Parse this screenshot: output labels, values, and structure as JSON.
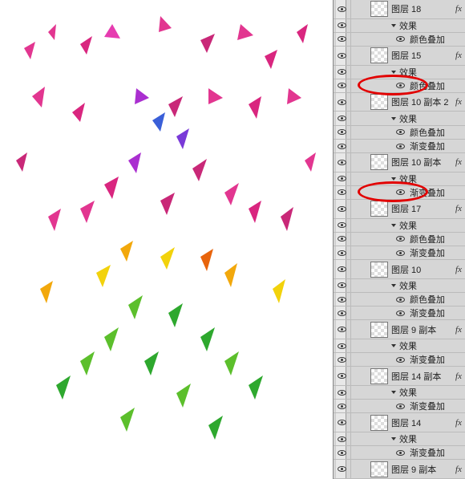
{
  "layers": [
    {
      "kind": "layer",
      "indent": 20,
      "name": "图层 18",
      "fx": "fx"
    },
    {
      "kind": "effects",
      "indent": 44,
      "name": "效果"
    },
    {
      "kind": "effect",
      "indent": 56,
      "name": "颜色叠加"
    },
    {
      "kind": "layer",
      "indent": 20,
      "name": "图层 15",
      "fx": "fx"
    },
    {
      "kind": "effects",
      "indent": 44,
      "name": "效果"
    },
    {
      "kind": "effect",
      "indent": 56,
      "name": "颜色叠加",
      "circled": true
    },
    {
      "kind": "layer",
      "indent": 20,
      "name": "图层 10 副本 2",
      "fx": "fx"
    },
    {
      "kind": "effects",
      "indent": 44,
      "name": "效果"
    },
    {
      "kind": "effect",
      "indent": 56,
      "name": "颜色叠加"
    },
    {
      "kind": "effect",
      "indent": 56,
      "name": "渐变叠加"
    },
    {
      "kind": "layer",
      "indent": 20,
      "name": "图层 10 副本",
      "fx": "fx"
    },
    {
      "kind": "effects",
      "indent": 44,
      "name": "效果"
    },
    {
      "kind": "effect",
      "indent": 56,
      "name": "渐变叠加",
      "circled": true
    },
    {
      "kind": "layer",
      "indent": 20,
      "name": "图层 17",
      "fx": "fx"
    },
    {
      "kind": "effects",
      "indent": 44,
      "name": "效果"
    },
    {
      "kind": "effect",
      "indent": 56,
      "name": "颜色叠加"
    },
    {
      "kind": "effect",
      "indent": 56,
      "name": "渐变叠加"
    },
    {
      "kind": "layer",
      "indent": 20,
      "name": "图层 10",
      "fx": "fx"
    },
    {
      "kind": "effects",
      "indent": 44,
      "name": "效果"
    },
    {
      "kind": "effect",
      "indent": 56,
      "name": "颜色叠加"
    },
    {
      "kind": "effect",
      "indent": 56,
      "name": "渐变叠加"
    },
    {
      "kind": "layer",
      "indent": 20,
      "name": "图层 9 副本",
      "fx": "fx"
    },
    {
      "kind": "effects",
      "indent": 44,
      "name": "效果"
    },
    {
      "kind": "effect",
      "indent": 56,
      "name": "渐变叠加"
    },
    {
      "kind": "layer",
      "indent": 20,
      "name": "图层 14 副本",
      "fx": "fx"
    },
    {
      "kind": "effects",
      "indent": 44,
      "name": "效果"
    },
    {
      "kind": "effect",
      "indent": 56,
      "name": "渐变叠加"
    },
    {
      "kind": "layer",
      "indent": 20,
      "name": "图层 14",
      "fx": "fx"
    },
    {
      "kind": "effects",
      "indent": 44,
      "name": "效果"
    },
    {
      "kind": "effect",
      "indent": 56,
      "name": "渐变叠加"
    },
    {
      "kind": "layer",
      "indent": 20,
      "name": "图层 9 副本",
      "fx": "fx"
    }
  ],
  "fx_label": "fx"
}
